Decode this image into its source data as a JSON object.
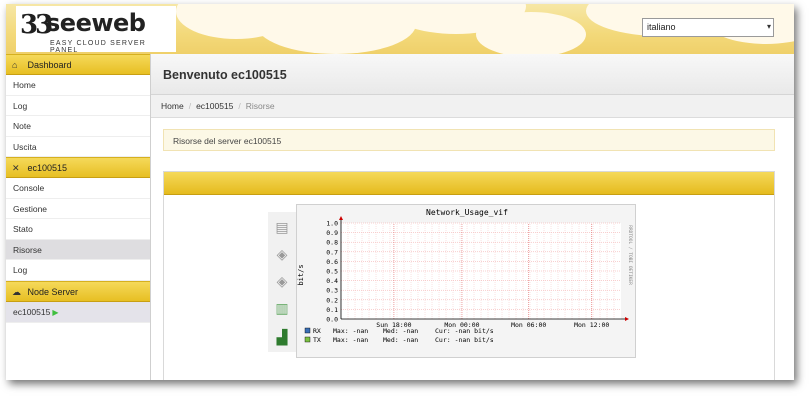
{
  "brand": {
    "name": "seeweb",
    "tagline": "EASY CLOUD SERVER PANEL"
  },
  "language": {
    "selected": "italiano"
  },
  "sidebar": {
    "sections": [
      {
        "title": "Dashboard",
        "icon": "home-icon",
        "items": [
          "Home",
          "Log",
          "Note",
          "Uscita"
        ]
      },
      {
        "title": "ec100515",
        "icon": "tools-icon",
        "items": [
          "Console",
          "Gestione",
          "Stato",
          "Risorse",
          "Log"
        ]
      },
      {
        "title": "Node Server",
        "icon": "cloud-icon",
        "items": [
          "ec100515"
        ]
      }
    ]
  },
  "page": {
    "title": "Benvenuto ec100515"
  },
  "breadcrumb": [
    "Home",
    "ec100515",
    "Risorse"
  ],
  "alert": "Risorse del server ec100515",
  "chart_data": {
    "type": "line",
    "title": "Network_Usage_vif",
    "ylabel": "bit/s",
    "ylim": [
      0,
      1.0
    ],
    "yticks": [
      "0.0",
      "0.1",
      "0.2",
      "0.3",
      "0.4",
      "0.5",
      "0.6",
      "0.7",
      "0.8",
      "0.9",
      "1.0"
    ],
    "xticks": [
      "Sun 18:00",
      "Mon 00:00",
      "Mon 06:00",
      "Mon 12:00"
    ],
    "watermark": "RRDTOOL / TOBI OETIKER",
    "grid": true,
    "series": [
      {
        "name": "RX",
        "color": "#3a6fb5",
        "values": []
      },
      {
        "name": "TX",
        "color": "#2e9b2e",
        "values": []
      }
    ],
    "legend_rows": [
      {
        "name": "RX",
        "color": "#3a6fb5",
        "max": "Max: -nan",
        "med": "Med: -nan",
        "cur": "Cur: -nan bit/s"
      },
      {
        "name": "TX",
        "color": "#7bc142",
        "max": "Max: -nan",
        "med": "Med: -nan",
        "cur": "Cur: -nan bit/s"
      }
    ]
  }
}
